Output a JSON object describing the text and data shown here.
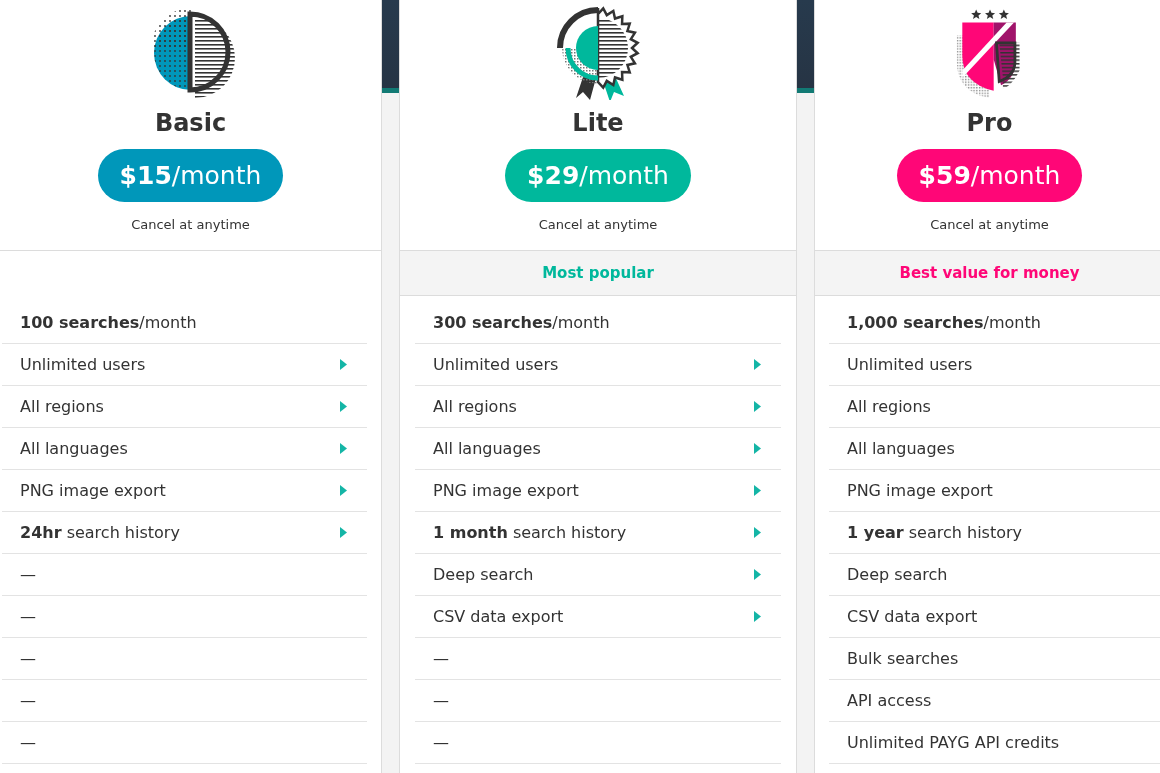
{
  "plans": [
    {
      "name": "Basic",
      "color": "#0097ba",
      "price": "**$15**/month",
      "note": "Cancel at anytime",
      "features": [
        {
          "text": "**100 searches**/month",
          "expandable": false
        },
        {
          "text": "Unlimited users",
          "expandable": true
        },
        {
          "text": "All regions",
          "expandable": true
        },
        {
          "text": "All languages",
          "expandable": true
        },
        {
          "text": "PNG image export",
          "expandable": true
        },
        {
          "text": "**24hr** search history",
          "expandable": true
        },
        {
          "text": "—",
          "expandable": false
        },
        {
          "text": "—",
          "expandable": false
        },
        {
          "text": "—",
          "expandable": false
        },
        {
          "text": "—",
          "expandable": false
        },
        {
          "text": "—",
          "expandable": false
        }
      ]
    },
    {
      "name": "Lite",
      "color": "#00b89c",
      "price": "**$29**/month",
      "note": "Cancel at anytime",
      "badge": "Most popular",
      "features": [
        {
          "text": "**300 searches**/month",
          "expandable": false
        },
        {
          "text": "Unlimited users",
          "expandable": true
        },
        {
          "text": "All regions",
          "expandable": true
        },
        {
          "text": "All languages",
          "expandable": true
        },
        {
          "text": "PNG image export",
          "expandable": true
        },
        {
          "text": "**1 month** search history",
          "expandable": true
        },
        {
          "text": "Deep search",
          "expandable": true
        },
        {
          "text": "CSV data export",
          "expandable": true
        },
        {
          "text": "—",
          "expandable": false
        },
        {
          "text": "—",
          "expandable": false
        },
        {
          "text": "—",
          "expandable": false
        }
      ]
    },
    {
      "name": "Pro",
      "color": "#ff0677",
      "price": "**$59**/month",
      "note": "Cancel at anytime",
      "badge": "Best value for money",
      "features": [
        {
          "text": "**1,000 searches**/month",
          "expandable": false
        },
        {
          "text": "Unlimited users",
          "expandable": false
        },
        {
          "text": "All regions",
          "expandable": false
        },
        {
          "text": "All languages",
          "expandable": false
        },
        {
          "text": "PNG image export",
          "expandable": false
        },
        {
          "text": "**1 year** search history",
          "expandable": false
        },
        {
          "text": "Deep search",
          "expandable": false
        },
        {
          "text": "CSV data export",
          "expandable": false
        },
        {
          "text": "Bulk searches",
          "expandable": false
        },
        {
          "text": "API access",
          "expandable": false
        },
        {
          "text": "Unlimited PAYG API credits",
          "expandable": false
        }
      ]
    }
  ]
}
